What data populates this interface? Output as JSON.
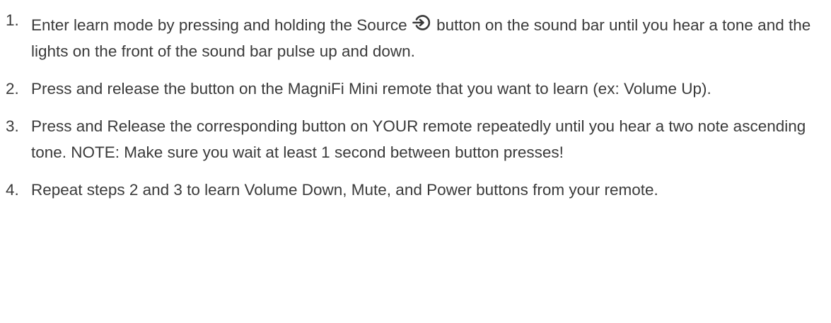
{
  "steps": [
    {
      "number": "1.",
      "text_before_icon": "Enter learn mode by pressing and holding the Source ",
      "icon": "source-icon",
      "text_after_icon": " button on the sound bar until you hear a tone and the lights on the front of the sound bar pulse up and down."
    },
    {
      "number": "2.",
      "text": "Press and release the button on the MagniFi Mini remote that you want to learn (ex: Volume Up)."
    },
    {
      "number": "3.",
      "text": "Press and Release the corresponding button on YOUR remote repeatedly until you hear a two note ascending tone. NOTE: Make sure you wait at least 1 second between button presses!"
    },
    {
      "number": "4.",
      "text": "Repeat steps 2 and 3 to learn Volume Down, Mute, and Power buttons from your remote."
    }
  ]
}
